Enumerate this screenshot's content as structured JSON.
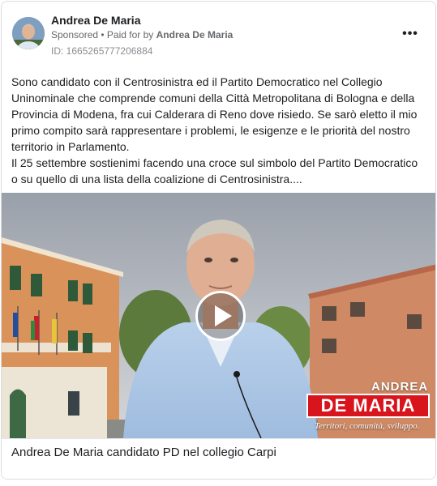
{
  "post": {
    "page_name": "Andrea De Maria",
    "sponsored_label": "Sponsored",
    "separator": " • ",
    "paid_for_prefix": "Paid for by ",
    "paid_for_name": "Andrea De Maria",
    "ad_id": "ID: 1665265777206884",
    "more_icon": "more-horizontal-icon",
    "more_label": "•••"
  },
  "body": {
    "lines": [
      "Sono candidato con il Centrosinistra ed il Partito Democratico nel Collegio",
      "Uninominale che comprende comuni della Città Metropolitana di Bologna e della",
      "Provincia di Modena, fra cui Calderara di Reno dove risiedo. Se sarò eletto il mio",
      "primo compito sarà rappresentare i problemi, le esigenze e le priorità del nostro",
      "territorio in Parlamento.",
      "Il 25 settembre sostienimi facendo una croce sul simbolo del Partito Democratico",
      "o su quello di una lista della coalizione di Centrosinistra...."
    ]
  },
  "video": {
    "play_icon": "play-icon",
    "brand_first": "ANDREA",
    "brand_last": "DE MARIA",
    "brand_tagline": "Territori, comunità, sviluppo.",
    "brand_color": "#d8141c"
  },
  "footer": {
    "caption": "Andrea De Maria candidato PD nel collegio Carpi"
  }
}
